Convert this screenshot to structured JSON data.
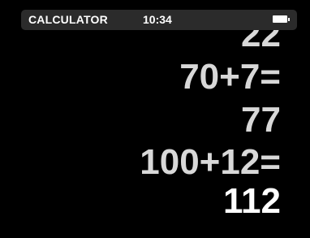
{
  "status_bar": {
    "app_title": "CALCULATOR",
    "time": "10:34",
    "battery_icon": "battery-full-icon"
  },
  "tape": {
    "lines": [
      "22",
      "70+7=",
      "77",
      "100+12=",
      "112"
    ]
  },
  "colors": {
    "background": "#000000",
    "status_bar": "#2b2b2b",
    "text_current": "#ffffff",
    "text_past": "#d8d8d8"
  }
}
